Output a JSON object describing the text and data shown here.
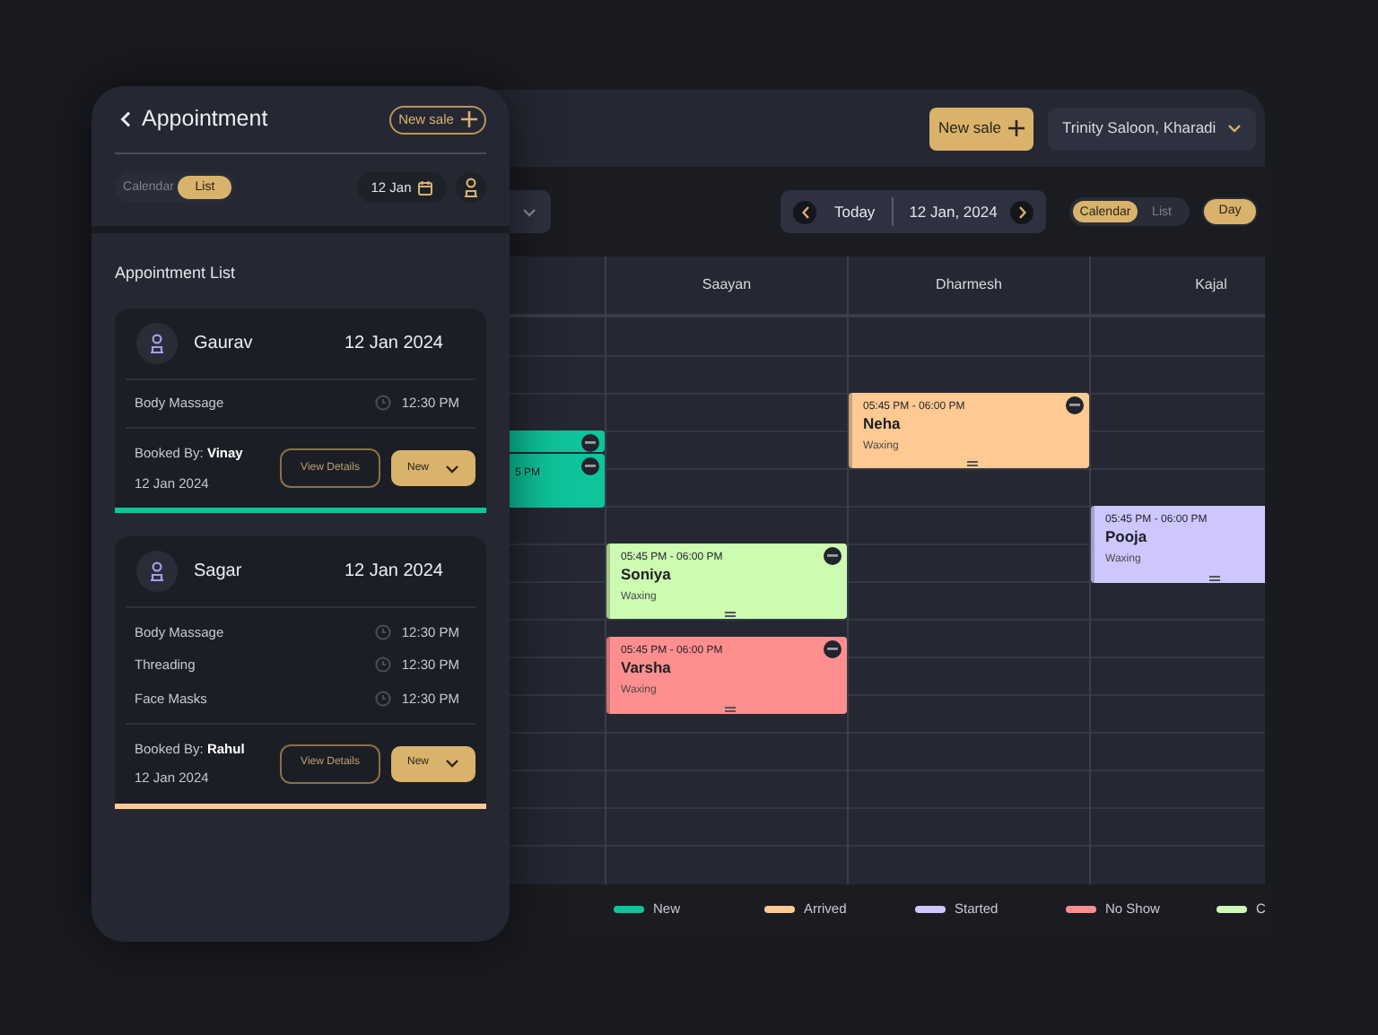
{
  "panel": {
    "title": "Appointment",
    "new_sale": "New sale",
    "view_toggle": [
      {
        "label": "Calendar",
        "selected": false
      },
      {
        "label": "List",
        "selected": true
      }
    ],
    "date": "12 Jan",
    "list_title": "Appointment List",
    "appointments": [
      {
        "customer": "Gaurav",
        "date": "12 Jan 2024",
        "services": [
          {
            "name": "Body Massage",
            "time": "12:30 PM"
          }
        ],
        "booked_by": "Booked By: **Vinay**",
        "booked_date": "12 Jan 2024",
        "view_button": "View Details",
        "status": "New",
        "color": "#0ec49a"
      },
      {
        "customer": "Sagar",
        "date": "12 Jan 2024",
        "services": [
          {
            "name": "Body Massage",
            "time": "12:30 PM"
          },
          {
            "name": "Threading",
            "time": "12:30 PM"
          },
          {
            "name": "Face Masks",
            "time": "12:30 PM"
          }
        ],
        "booked_by": "Booked By: **Rahul**",
        "booked_date": "12 Jan 2024",
        "view_button": "View Details",
        "status": "New",
        "color": "#ffc993"
      }
    ]
  },
  "calendar": {
    "new_sale": "New sale",
    "location": "Trinity Saloon, Kharadi",
    "today": "Today",
    "date": "12 Jan, 2024",
    "view_toggle": [
      {
        "label": "Calendar",
        "selected": true
      },
      {
        "label": "List",
        "selected": false
      }
    ],
    "range": [
      {
        "label": "Day",
        "selected": true
      }
    ],
    "columns": [
      {
        "events": [
          {
            "color": "#0ec49a"
          },
          {
            "time": "5 PM",
            "color": "#0ec49a"
          }
        ]
      },
      {
        "name": "Saayan",
        "events": [
          {
            "time": "05:45 PM - 06:00 PM",
            "name": "Soniya",
            "service": "Waxing",
            "color": "#ccfbb1"
          },
          {
            "time": "05:45 PM - 06:00 PM",
            "name": "Varsha",
            "service": "Waxing",
            "color": "#ff8f8f"
          }
        ]
      },
      {
        "name": "Dharmesh",
        "events": [
          {
            "time": "05:45 PM - 06:00 PM",
            "name": "Neha",
            "service": "Waxing",
            "color": "#ffc993"
          }
        ]
      },
      {
        "name": "Kajal",
        "events": [
          {
            "time": "05:45 PM - 06:00 PM",
            "name": "Pooja",
            "service": "Waxing",
            "color": "#cdc7fe"
          }
        ]
      }
    ],
    "legend": [
      {
        "label": "New",
        "color": "#0ec49a"
      },
      {
        "label": "Arrived",
        "color": "#ffc993"
      },
      {
        "label": "Started",
        "color": "#cdc7fe"
      },
      {
        "label": "No Show",
        "color": "#ff8f8f"
      },
      {
        "label": "C",
        "color": "#ccfbb1"
      }
    ]
  }
}
